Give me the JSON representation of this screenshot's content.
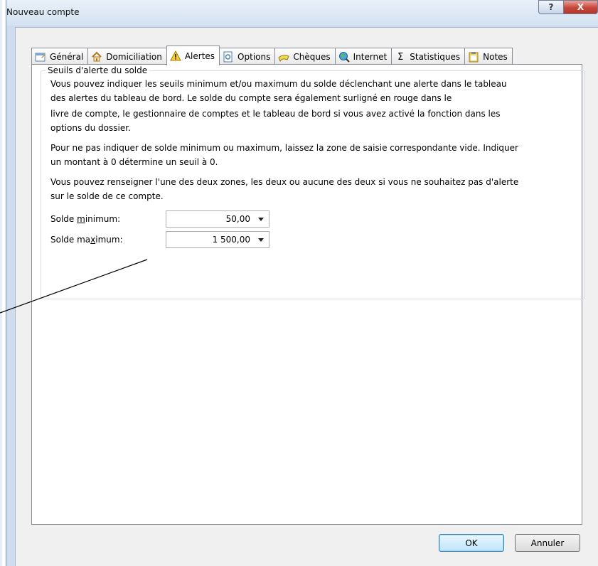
{
  "window": {
    "title": "Nouveau compte",
    "help_label": "?",
    "close_label": "X"
  },
  "tabs": [
    {
      "label": "Général",
      "icon": "general-icon"
    },
    {
      "label": "Domiciliation",
      "icon": "house-icon"
    },
    {
      "label": "Alertes",
      "icon": "warning-icon",
      "active": true
    },
    {
      "label": "Options",
      "icon": "options-icon"
    },
    {
      "label": "Chèques",
      "icon": "cheque-icon"
    },
    {
      "label": "Internet",
      "icon": "globe-icon"
    },
    {
      "label": "Statistiques",
      "icon": "sigma-icon"
    },
    {
      "label": "Notes",
      "icon": "notes-icon"
    }
  ],
  "group": {
    "title": "Seuils d'alerte du solde",
    "paragraphs": [
      "Vous pouvez indiquer les seuils minimum et/ou maximum du solde déclenchant une alerte dans le tableau",
      "des alertes du tableau de bord. Le solde du compte sera également surligné en rouge dans le",
      "livre de compte, le gestionnaire de comptes et le tableau de bord si vous avez activé la fonction dans les",
      "options du dossier.",
      "Pour ne pas indiquer de solde minimum ou maximum, laissez la zone de saisie correspondante vide. Indiquer",
      "un montant à 0 détermine un seuil à 0.",
      "Vous pouvez renseigner l'une des deux zones, les deux ou aucune des deux si vous ne souhaitez pas d'alerte",
      "sur le solde de ce compte."
    ],
    "min_label_pre": "Solde ",
    "min_label_acc": "m",
    "min_label_post": "inimum:",
    "min_value": "50,00",
    "max_label_pre": "Solde ma",
    "max_label_acc": "x",
    "max_label_post": "imum:",
    "max_value": "1 500,00"
  },
  "buttons": {
    "ok": "OK",
    "cancel": "Annuler"
  }
}
